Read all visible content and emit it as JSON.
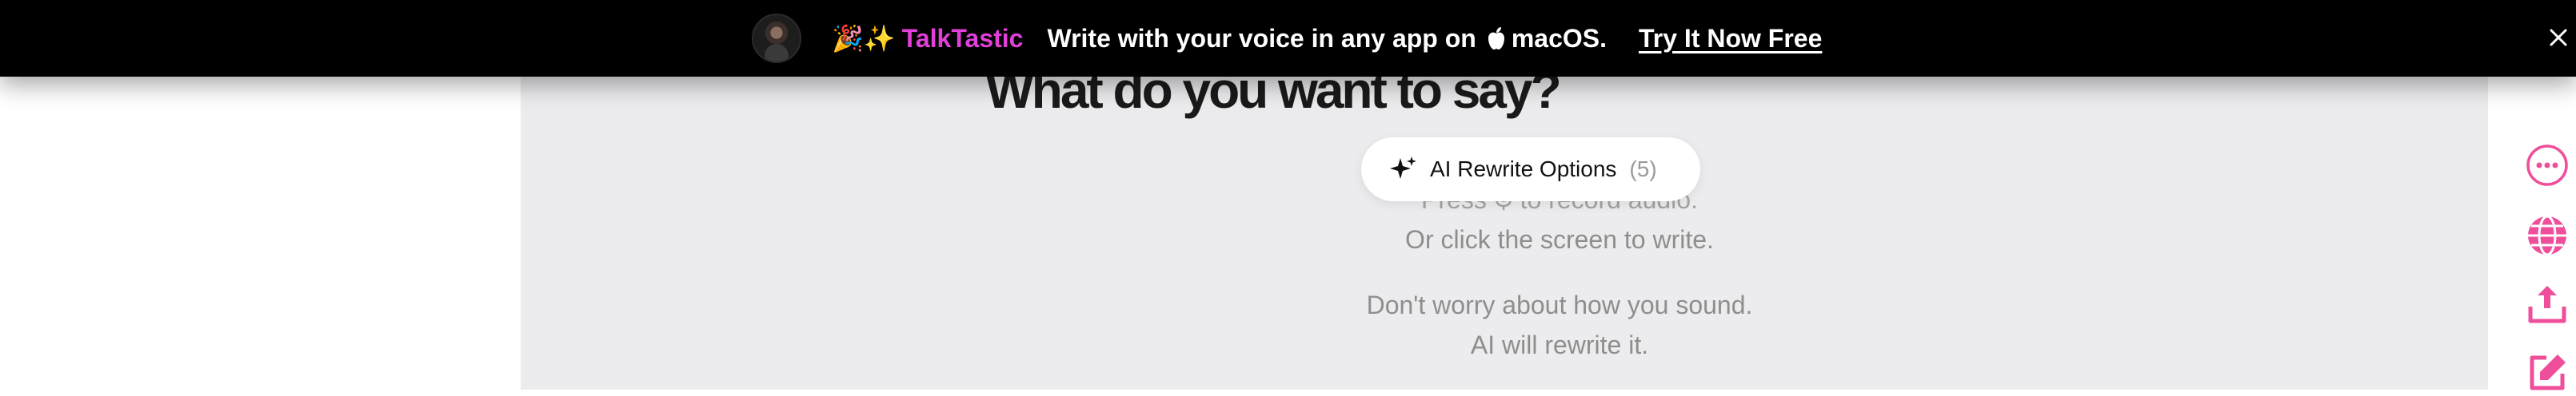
{
  "banner": {
    "emoji": "🎉✨",
    "brand": "TalkTastic",
    "tagline": "Write with your voice in any app on",
    "os_name": "macOS.",
    "cta": "Try It Now Free"
  },
  "main": {
    "heading": "What do you want to say?",
    "rewrite_button": {
      "label": "AI Rewrite Options",
      "count": "(5)"
    },
    "instructions": {
      "line1_prefix": "Press",
      "line1_suffix": "to record audio.",
      "line2": "Or click the screen to write.",
      "line3": "Don't worry about how you sound.",
      "line4": "AI will rewrite it."
    }
  },
  "colors": {
    "brand": "#e040d8",
    "accent_icons": "#ef4f9a",
    "canvas": "#ececee",
    "banner": "#000000"
  },
  "icons": {
    "banner_close": "close-icon",
    "sparkle": "sparkle-icon",
    "mic": "microphone-icon",
    "more": "more-options-icon",
    "language": "globe-icon",
    "share": "share-upload-icon",
    "edit": "edit-icon"
  }
}
